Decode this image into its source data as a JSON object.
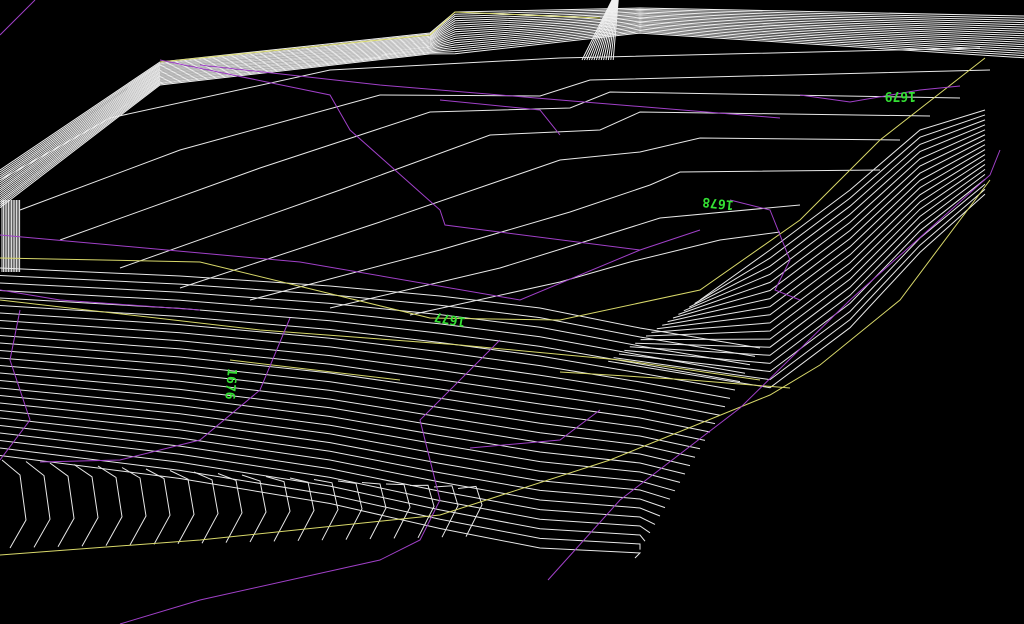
{
  "drawing": {
    "background": "#000000",
    "contour_color": "#e8e8e8",
    "boundary_color": "#d8d86a",
    "property_line_color": "#a040c8",
    "label_color": "#34e034"
  },
  "labels": {
    "elev_top_right": "1679",
    "elev_mid_right": "1678",
    "elev_center": "1677",
    "elev_left": "1676"
  }
}
